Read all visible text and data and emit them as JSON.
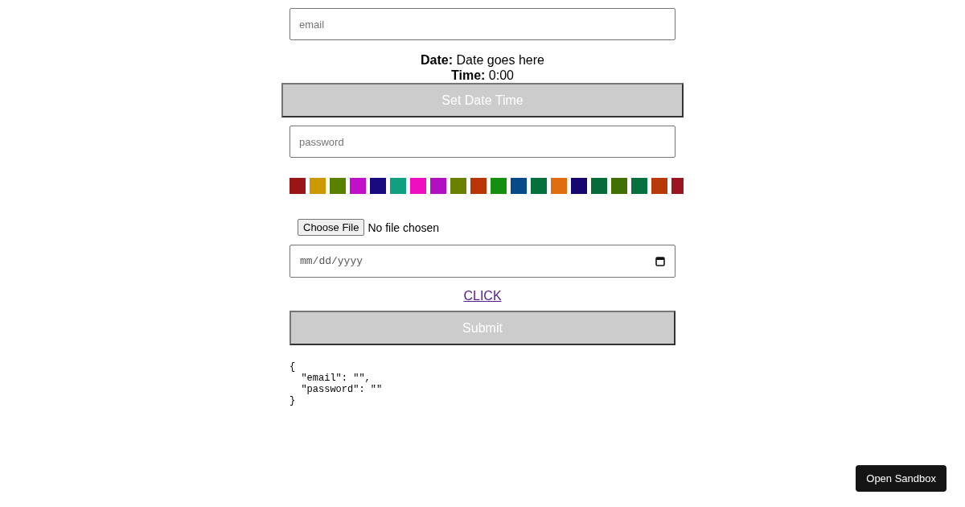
{
  "email_field": {
    "placeholder": "email"
  },
  "date_info": {
    "date_label": "Date:",
    "date_value": "Date goes here",
    "time_label": "Time:",
    "time_value": "0:00"
  },
  "set_button": "Set Date Time",
  "password_field": {
    "placeholder": "password"
  },
  "swatches": [
    {
      "color": "#9a1515"
    },
    {
      "color": "#cc9900"
    },
    {
      "color": "#5a8000"
    },
    {
      "color": "#c010c8"
    },
    {
      "color": "#1a0a80"
    },
    {
      "color": "#10a080"
    },
    {
      "color": "#ee10c0"
    },
    {
      "color": "#b010c0"
    },
    {
      "color": "#6a8000"
    },
    {
      "color": "#b83508"
    },
    {
      "color": "#149010"
    },
    {
      "color": "#064a88"
    },
    {
      "color": "#04703a"
    },
    {
      "color": "#e06c10"
    },
    {
      "color": "#160670"
    },
    {
      "color": "#046c38"
    },
    {
      "color": "#427000"
    },
    {
      "color": "#06703e"
    },
    {
      "color": "#b83a08"
    },
    {
      "color": "#9a1520"
    }
  ],
  "file_input": {
    "button": "Choose File",
    "status": "No file chosen"
  },
  "date_field": {
    "placeholder": "mm/dd/yyyy"
  },
  "link": "CLICK",
  "submit_button": "Submit",
  "output": "{\n  \"email\": \"\",\n  \"password\": \"\"\n}",
  "sandbox_button": "Open Sandbox"
}
